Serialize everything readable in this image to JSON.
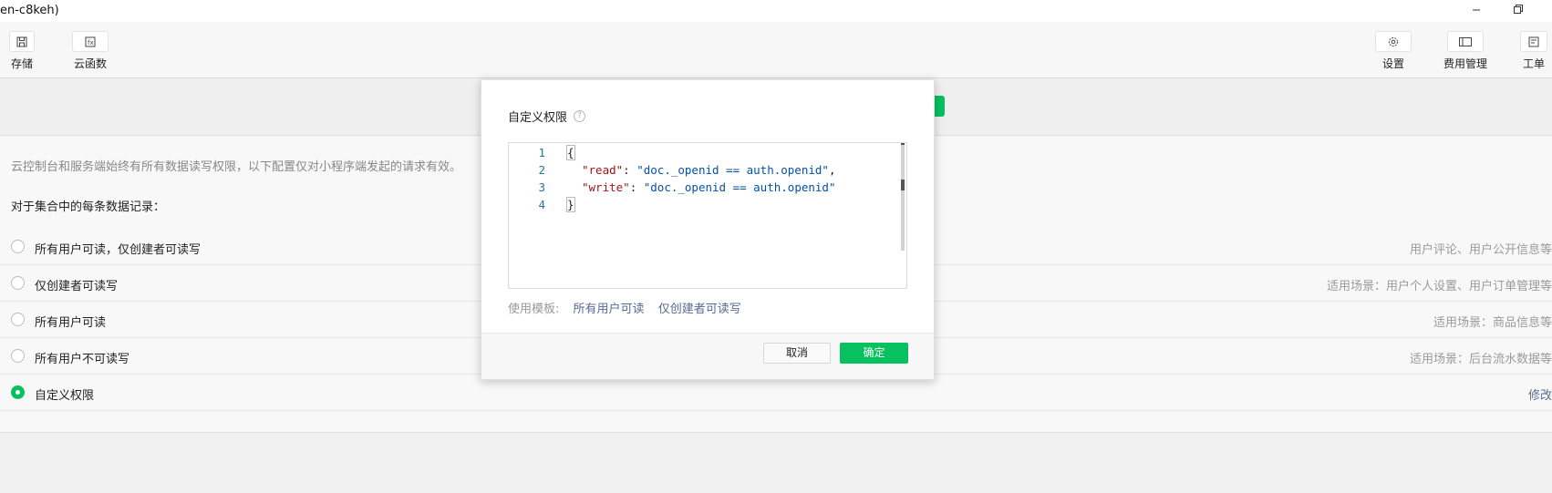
{
  "window": {
    "title": "en-c8keh)",
    "minimize_icon": "minimize-icon",
    "restore_icon": "restore-icon"
  },
  "toolbar": {
    "left": [
      {
        "label": "存储",
        "icon": "save-icon"
      },
      {
        "label": "云函数",
        "icon": "cloud-function-icon"
      }
    ],
    "right": [
      {
        "label": "设置",
        "icon": "gear-icon"
      },
      {
        "label": "费用管理",
        "icon": "billing-icon"
      },
      {
        "label": "工单",
        "icon": "ticket-icon"
      }
    ]
  },
  "main": {
    "note": "云控制台和服务端始终有所有数据读写权限，以下配置仅对小程序端发起的请求有效。",
    "subhead": "对于集合中的每条数据记录：",
    "options": [
      {
        "label": "所有用户可读，仅创建者可读写",
        "hint": "用户评论、用户公开信息等",
        "selected": false
      },
      {
        "label": "仅创建者可读写",
        "hint": "适用场景：用户个人设置、用户订单管理等",
        "selected": false
      },
      {
        "label": "所有用户可读",
        "hint": "适用场景：商品信息等",
        "selected": false
      },
      {
        "label": "所有用户不可读写",
        "hint": "适用场景：后台流水数据等",
        "selected": false
      },
      {
        "label": "自定义权限",
        "hint": "修改",
        "selected": true
      }
    ]
  },
  "dialog": {
    "title": "自定义权限",
    "help_icon": "question-icon",
    "code_lines": [
      {
        "num": "1",
        "text": "{"
      },
      {
        "num": "2",
        "key": "\"read\"",
        "sep": ": ",
        "value": "\"doc._openid == auth.openid\"",
        "tail": ","
      },
      {
        "num": "3",
        "key": "\"write\"",
        "sep": ": ",
        "value": "\"doc._openid == auth.openid\"",
        "tail": ""
      },
      {
        "num": "4",
        "text": "}"
      }
    ],
    "template_prefix": "使用模板:",
    "templates": [
      "所有用户可读",
      "仅创建者可读写"
    ],
    "cancel": "取消",
    "ok": "确定"
  },
  "colors": {
    "accent": "#07c160",
    "link": "#576b95"
  }
}
